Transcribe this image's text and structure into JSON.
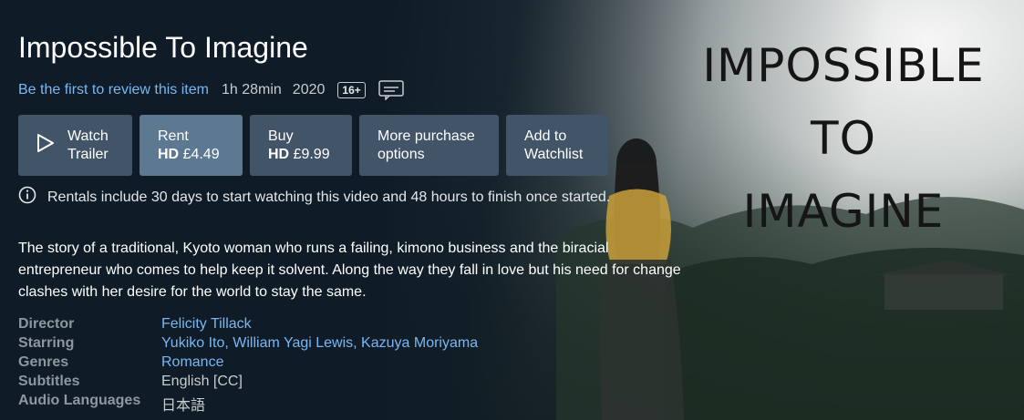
{
  "title": "Impossible To Imagine",
  "meta": {
    "review_link": "Be the first to review this item",
    "runtime": "1h 28min",
    "year": "2020",
    "age_rating": "16+"
  },
  "buttons": {
    "trailer": {
      "line1": "Watch",
      "line2": "Trailer"
    },
    "rent": {
      "line1": "Rent",
      "quality": "HD",
      "price": "£4.49"
    },
    "buy": {
      "line1": "Buy",
      "quality": "HD",
      "price": "£9.99"
    },
    "more": {
      "line1": "More purchase",
      "line2": "options"
    },
    "watchlist": {
      "line1": "Add to",
      "line2": "Watchlist"
    }
  },
  "rental_note": "Rentals include 30 days to start watching this video and 48 hours to finish once started.",
  "synopsis": {
    "line1": "The story of a traditional, Kyoto woman who runs a failing, kimono business and the biracial",
    "line2": "entrepreneur who comes to help keep it solvent. Along the way they fall in love but his need for change",
    "line3": "clashes with her desire for the world to stay the same."
  },
  "details": {
    "director_label": "Director",
    "director": "Felicity Tillack",
    "starring_label": "Starring",
    "starring": "Yukiko Ito, William Yagi Lewis, Kazuya Moriyama",
    "genres_label": "Genres",
    "genres": "Romance",
    "subtitles_label": "Subtitles",
    "subtitles": "English [CC]",
    "audio_label": "Audio Languages",
    "audio": "日本語"
  },
  "poster": {
    "line1": "IMPOSSIBLE",
    "line2": "TO",
    "line3": "IMAGINE"
  },
  "colors": {
    "background": "#0f1b26",
    "button": "#425467",
    "button_highlight": "#5d7891",
    "link": "#79b8f3"
  },
  "icons": [
    "play-icon",
    "subtitles-icon",
    "info-icon"
  ]
}
